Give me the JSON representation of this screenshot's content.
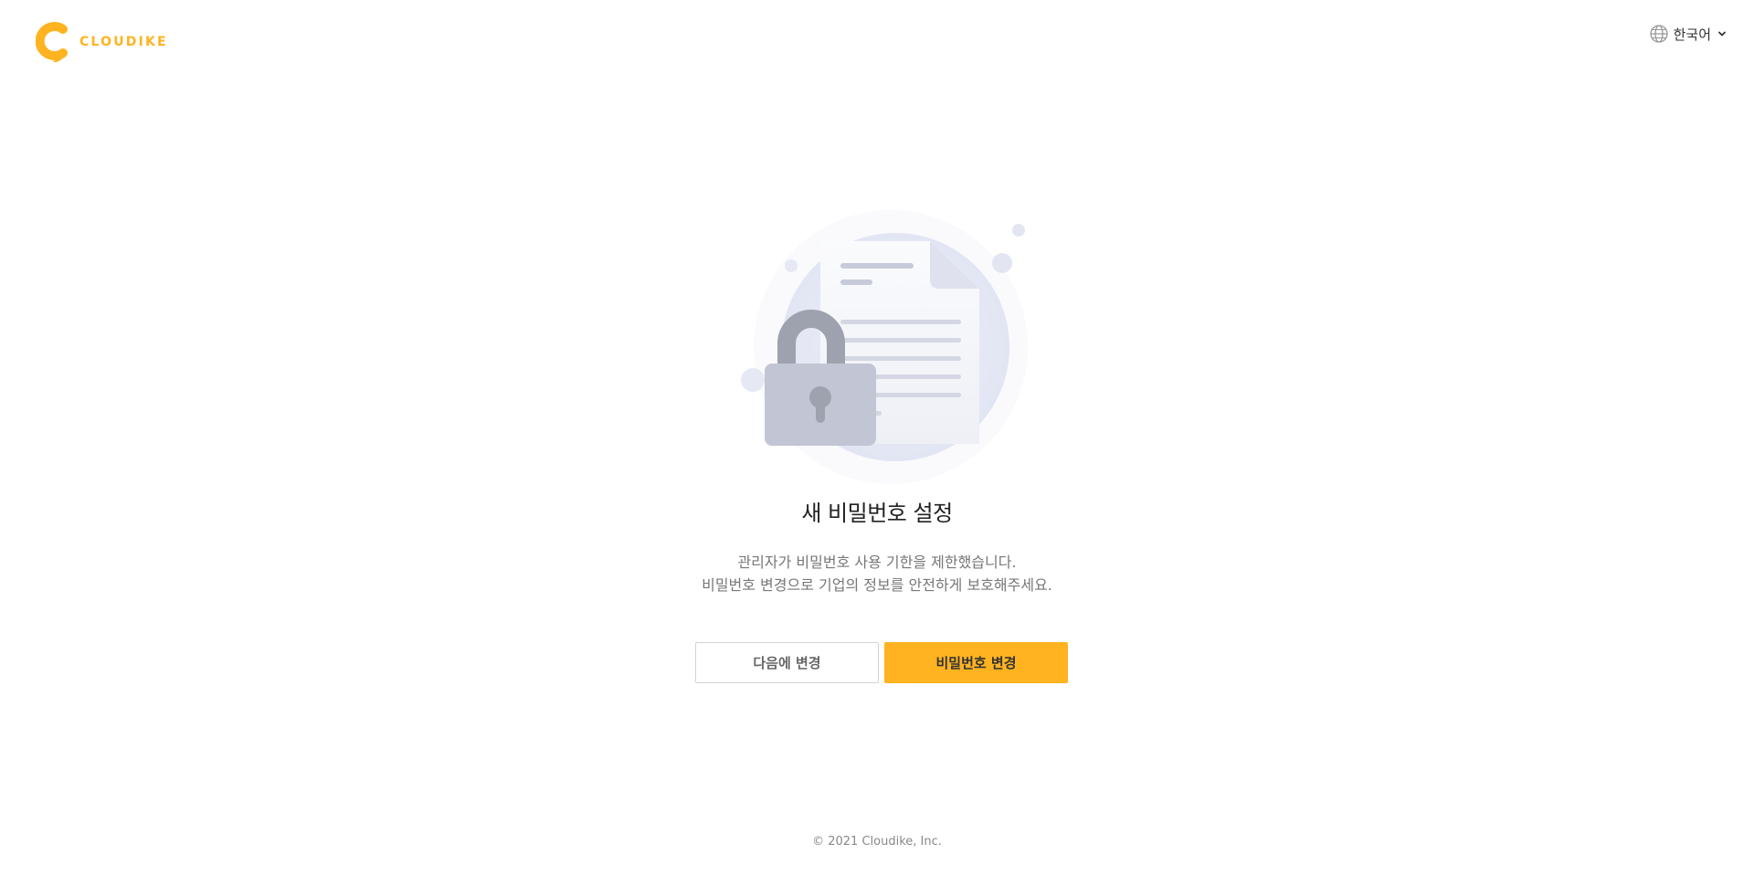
{
  "header": {
    "logo_text": "CLOUDIKE",
    "language": {
      "selected": "한국어",
      "icon": "globe-icon",
      "dropdown_icon": "chevron-down-icon"
    }
  },
  "main": {
    "illustration_icon": "locked-document-illustration",
    "title": "새 비밀번호 설정",
    "description_line1": "관리자가 비밀번호 사용 기한을 제한했습니다.",
    "description_line2": "비밀번호 변경으로 기업의 정보를 안전하게 보호해주세요.",
    "buttons": {
      "later_label": "다음에 변경",
      "change_label": "비밀번호 변경"
    }
  },
  "footer": {
    "copyright": "© 2021 Cloudike, Inc."
  },
  "colors": {
    "accent": "#ffb320",
    "text_primary": "#222222",
    "text_secondary": "#777777",
    "border": "#d4d4d4"
  }
}
